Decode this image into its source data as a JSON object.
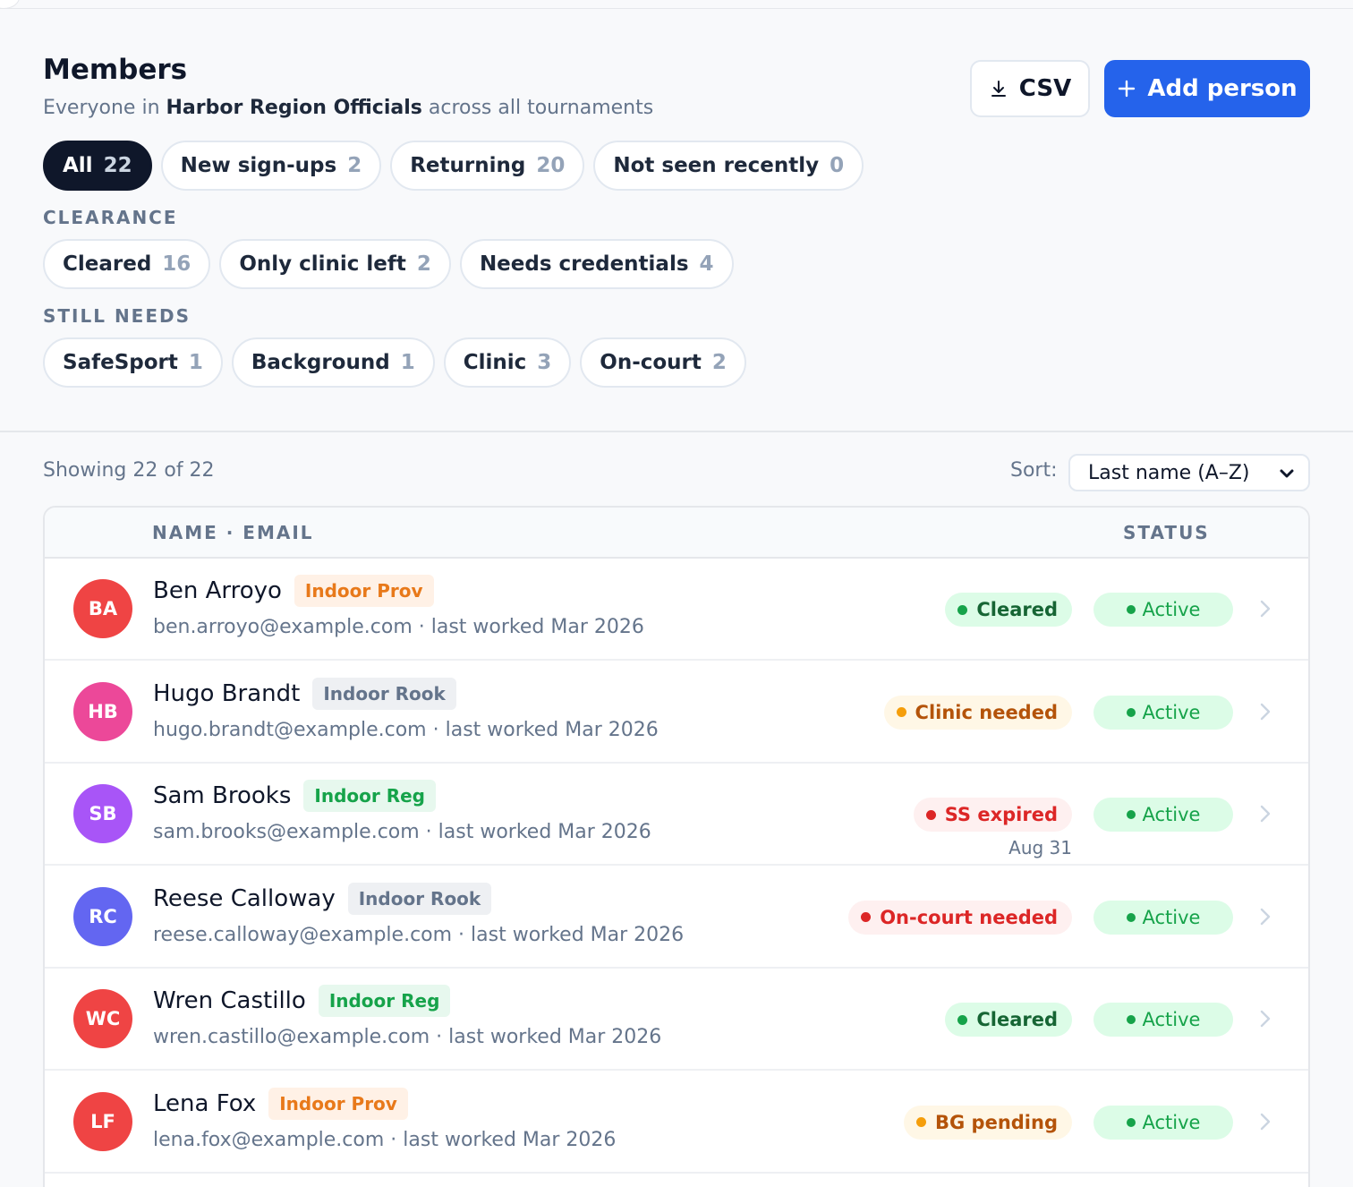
{
  "header": {
    "title": "Members",
    "subtitle_prefix": "Everyone in ",
    "org_name": "Harbor Region Officials",
    "subtitle_suffix": " across all tournaments",
    "csv_label": "CSV",
    "add_label": "Add person"
  },
  "filters": [
    {
      "label": "All",
      "count": "22"
    },
    {
      "label": "New sign-ups",
      "count": "2"
    },
    {
      "label": "Returning",
      "count": "20"
    },
    {
      "label": "Not seen recently",
      "count": "0"
    }
  ],
  "clearance": {
    "label": "CLEARANCE",
    "chips": [
      {
        "label": "Cleared",
        "count": "16"
      },
      {
        "label": "Only clinic left",
        "count": "2"
      },
      {
        "label": "Needs credentials",
        "count": "4"
      }
    ]
  },
  "still_needs": {
    "label": "STILL NEEDS",
    "chips": [
      {
        "label": "SafeSport",
        "count": "1"
      },
      {
        "label": "Background",
        "count": "1"
      },
      {
        "label": "Clinic",
        "count": "3"
      },
      {
        "label": "On-court",
        "count": "2"
      }
    ]
  },
  "list": {
    "showing": "Showing 22 of 22",
    "sort_label": "Sort:",
    "sort_value": "Last name (A–Z)"
  },
  "table": {
    "col_name": "NAME · EMAIL",
    "col_status": "STATUS",
    "rows": [
      {
        "initials": "BA",
        "avatar_color": "#ef4444",
        "name": "Ben Arroyo",
        "level": "Indoor Prov",
        "email": "ben.arroyo@example.com",
        "last_worked": " · last worked Mar 2026",
        "status": "Cleared",
        "status_kind": "green",
        "status_sub": "",
        "active": "Active"
      },
      {
        "initials": "HB",
        "avatar_color": "#ec4899",
        "name": "Hugo Brandt",
        "level": "Indoor Rook",
        "email": "hugo.brandt@example.com",
        "last_worked": " · last worked Mar 2026",
        "status": "Clinic needed",
        "status_kind": "amber",
        "status_sub": "",
        "active": "Active"
      },
      {
        "initials": "SB",
        "avatar_color": "#a855f7",
        "name": "Sam Brooks",
        "level": "Indoor Reg",
        "email": "sam.brooks@example.com",
        "last_worked": " · last worked Mar 2026",
        "status": "SS expired",
        "status_kind": "red",
        "status_sub": "Aug 31",
        "active": "Active"
      },
      {
        "initials": "RC",
        "avatar_color": "#6366f1",
        "name": "Reese Calloway",
        "level": "Indoor Rook",
        "email": "reese.calloway@example.com",
        "last_worked": " · last worked Mar 2026",
        "status": "On-court needed",
        "status_kind": "red",
        "status_sub": "",
        "active": "Active"
      },
      {
        "initials": "WC",
        "avatar_color": "#ef4444",
        "name": "Wren Castillo",
        "level": "Indoor Reg",
        "email": "wren.castillo@example.com",
        "last_worked": " · last worked Mar 2026",
        "status": "Cleared",
        "status_kind": "green",
        "status_sub": "",
        "active": "Active"
      },
      {
        "initials": "LF",
        "avatar_color": "#ef4444",
        "name": "Lena Fox",
        "level": "Indoor Prov",
        "email": "lena.fox@example.com",
        "last_worked": " · last worked Mar 2026",
        "status": "BG pending",
        "status_kind": "amber",
        "status_sub": "",
        "active": "Active"
      }
    ]
  }
}
